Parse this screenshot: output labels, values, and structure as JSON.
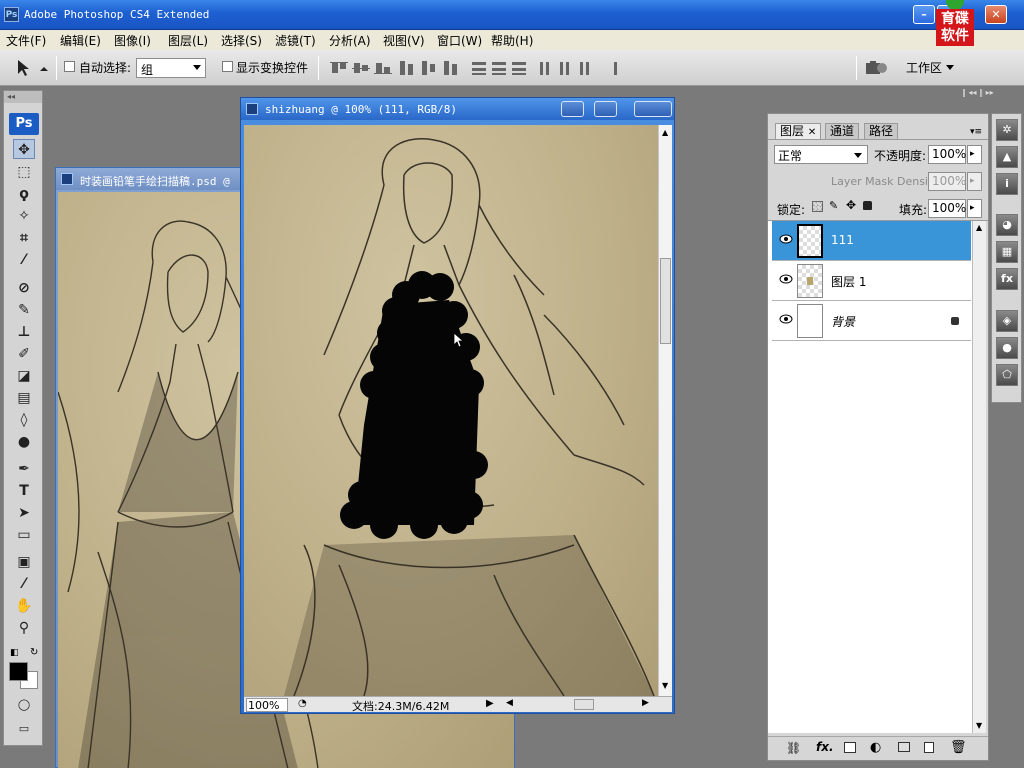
{
  "window": {
    "title": "Adobe Photoshop CS4 Extended",
    "app_badge": "Ps",
    "brand_text": "育碟软件"
  },
  "menu": [
    "文件(F)",
    "编辑(E)",
    "图像(I)",
    "图层(L)",
    "选择(S)",
    "滤镜(T)",
    "分析(A)",
    "视图(V)",
    "窗口(W)",
    "帮助(H)"
  ],
  "options": {
    "auto_select_label": "自动选择:",
    "auto_select_value": "组",
    "show_transform_label": "显示变换控件",
    "workspace_label": "工作区"
  },
  "toolbox": {
    "badge": "Ps",
    "fg_color": "#000000",
    "bg_color": "#ffffff"
  },
  "doc_back": {
    "title": "时装画铅笔手绘扫描稿.psd @"
  },
  "doc_front": {
    "title": "shizhuang @ 100% (111, RGB/8)",
    "zoom": "100%",
    "doc_info": "文档:24.3M/6.42M"
  },
  "layers_panel": {
    "tabs": [
      "图层",
      "通道",
      "路径"
    ],
    "blend_mode": "正常",
    "opacity_label": "不透明度:",
    "opacity_value": "100%",
    "mask_density_label": "Layer Mask Density",
    "mask_density_value": "100%",
    "lock_label": "锁定:",
    "fill_label": "填充:",
    "fill_value": "100%",
    "layers": [
      {
        "name": "111",
        "selected": true
      },
      {
        "name": "图层 1",
        "selected": false
      },
      {
        "name": "背景",
        "selected": false,
        "locked": true
      }
    ]
  },
  "colors": {
    "selection": "#3a95d8",
    "title_blue": "#1d5fd1",
    "paper": "#bfb18a"
  }
}
